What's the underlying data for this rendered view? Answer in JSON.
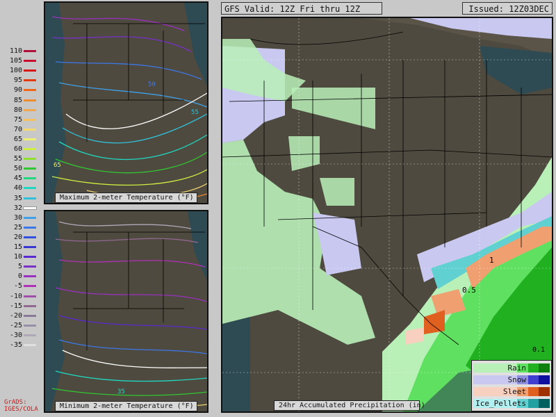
{
  "header": {
    "valid": "GFS Valid: 12Z Fri thru 12Z Sat",
    "issued": "Issued: 12Z03DEC"
  },
  "panels": {
    "max_temp": {
      "caption": "Maximum 2-meter Temperature (°F)",
      "labels": [
        "50",
        "55",
        "65"
      ]
    },
    "min_temp": {
      "caption": "Minimum 2-meter Temperature (°F)",
      "labels": [
        "35"
      ]
    },
    "precip": {
      "caption": "24hr Accumulated Precipitation (in)",
      "labels": [
        "1",
        "0.5",
        "0.1"
      ]
    }
  },
  "temp_legend": [
    {
      "value": "110",
      "color": "#b0103a"
    },
    {
      "value": "105",
      "color": "#c8102e"
    },
    {
      "value": "100",
      "color": "#d81818"
    },
    {
      "value": "95",
      "color": "#e83a10"
    },
    {
      "value": "90",
      "color": "#f06818"
    },
    {
      "value": "85",
      "color": "#f08c30"
    },
    {
      "value": "80",
      "color": "#f0a850"
    },
    {
      "value": "75",
      "color": "#f4c060"
    },
    {
      "value": "70",
      "color": "#f4d870"
    },
    {
      "value": "65",
      "color": "#f0f070"
    },
    {
      "value": "60",
      "color": "#d0f040"
    },
    {
      "value": "55",
      "color": "#90e030"
    },
    {
      "value": "50",
      "color": "#30c830"
    },
    {
      "value": "45",
      "color": "#20d880"
    },
    {
      "value": "40",
      "color": "#20d8c0"
    },
    {
      "value": "35",
      "color": "#30c0d8"
    },
    {
      "value": "32",
      "color": "#ffffff"
    },
    {
      "value": "30",
      "color": "#40a0e8"
    },
    {
      "value": "25",
      "color": "#3c78e8"
    },
    {
      "value": "20",
      "color": "#3050e0"
    },
    {
      "value": "15",
      "color": "#3838d0"
    },
    {
      "value": "10",
      "color": "#5a28d0"
    },
    {
      "value": "5",
      "color": "#7830c8"
    },
    {
      "value": "0",
      "color": "#9a30c0"
    },
    {
      "value": "-5",
      "color": "#b030b8"
    },
    {
      "value": "-10",
      "color": "#a050a8"
    },
    {
      "value": "-15",
      "color": "#906890"
    },
    {
      "value": "-20",
      "color": "#8a7898"
    },
    {
      "value": "-25",
      "color": "#9890a8"
    },
    {
      "value": "-30",
      "color": "#b0a8b8"
    },
    {
      "value": "-35",
      "color": "#e0e0e0"
    }
  ],
  "precip_legend": [
    {
      "label": "Rain",
      "colors": [
        "#b8f0b8",
        "#60e060",
        "#20b020",
        "#108010"
      ]
    },
    {
      "label": "Snow",
      "colors": [
        "#c8c8f0",
        "#9090e0",
        "#4040d0",
        "#1010a0"
      ]
    },
    {
      "label": "Sleet",
      "colors": [
        "#f8d0c0",
        "#f0a070",
        "#e06020",
        "#a03000"
      ]
    },
    {
      "label": "Ice_Pellets",
      "colors": [
        "#b0f0f0",
        "#60d0d0",
        "#20a0a0",
        "#006060"
      ]
    }
  ],
  "credit": {
    "line1": "GrADS:",
    "line2": "IGES/COLA"
  },
  "colors": {
    "terrain": "#4f4a40",
    "ocean": "#2e4a52",
    "border": "#000000"
  }
}
